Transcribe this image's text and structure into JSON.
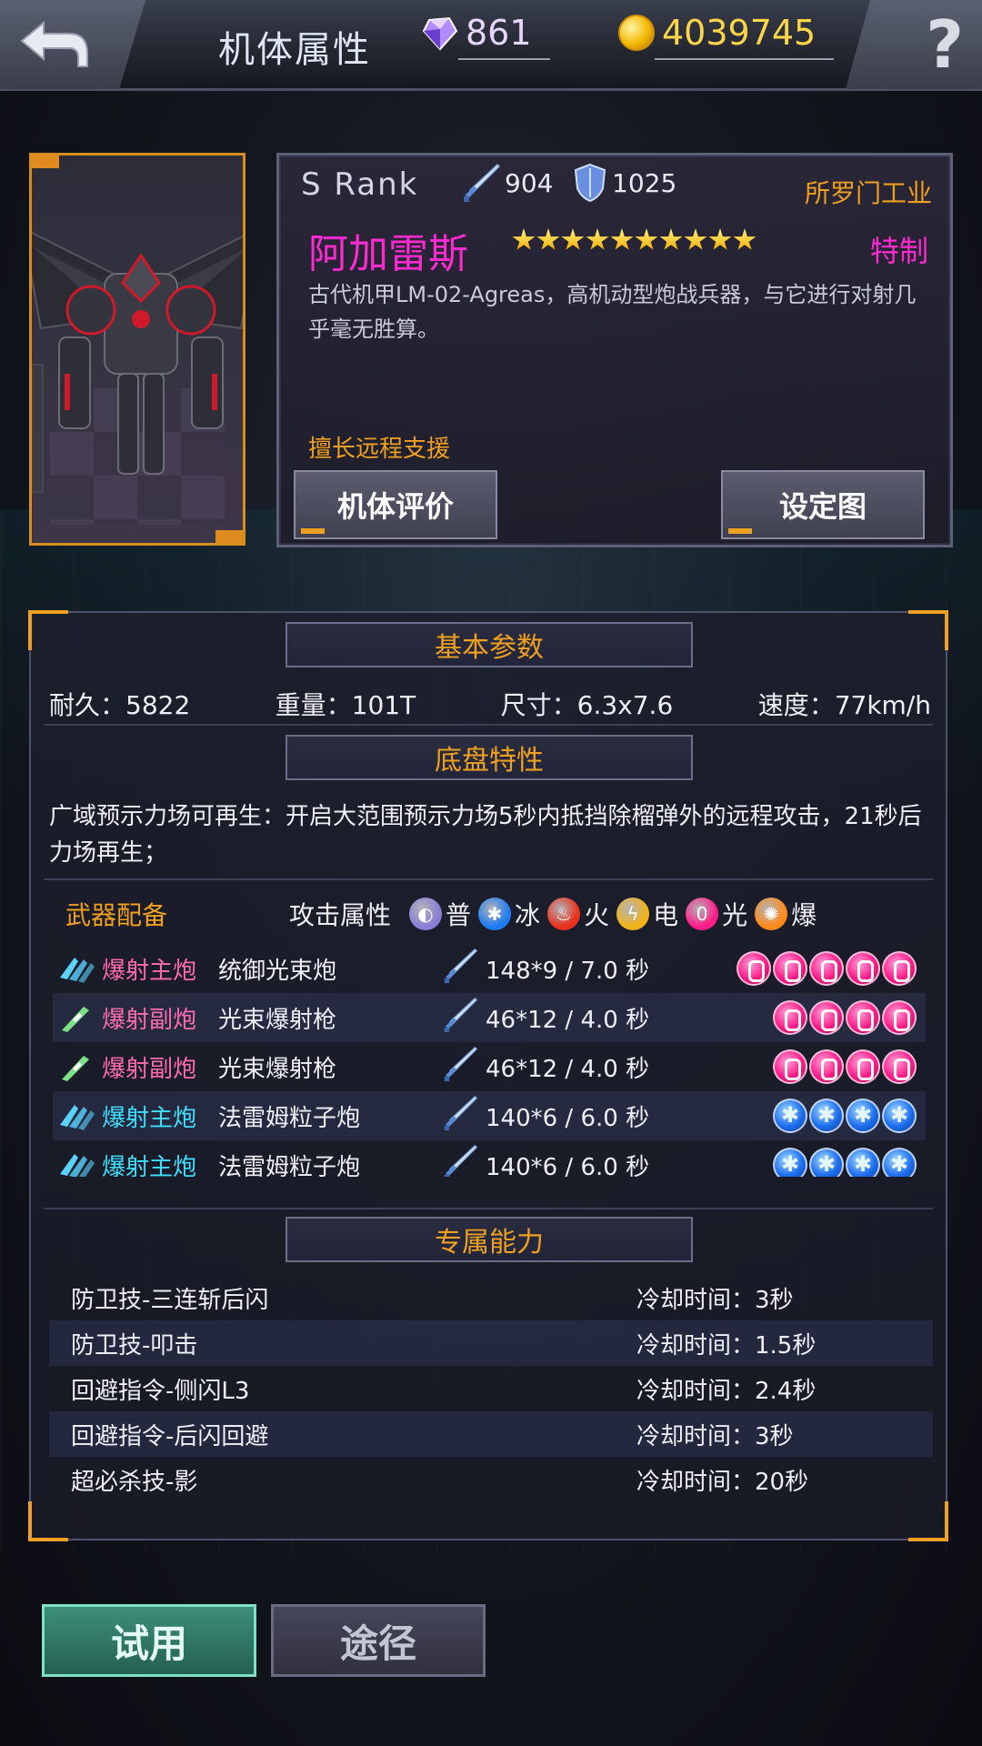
{
  "header": {
    "title": "机体属性",
    "gems": "861",
    "gold": "4039745",
    "help_label": "?"
  },
  "mech": {
    "rank": "S  Rank",
    "attack": "904",
    "defense": "1025",
    "manufacturer": "所罗门工业",
    "name": "阿加雷斯",
    "stars": 10,
    "tag": "特制",
    "description": "古代机甲LM-02-Agreas，高机动型炮战兵器，与它进行对射几乎毫无胜算。",
    "specialty": "擅长远程支援",
    "eval_button": "机体评价",
    "design_button": "设定图"
  },
  "basic": {
    "title": "基本参数",
    "durability": "耐久：5822",
    "weight": "重量：101T",
    "size": "尺寸：6.3x7.6",
    "speed": "速度：77km/h"
  },
  "chassis": {
    "title": "底盘特性",
    "text": "广域预示力场可再生：开启大范围预示力场5秒内抵挡除榴弹外的远程攻击，21秒后力场再生；"
  },
  "weapons": {
    "title": "武器配备",
    "attr_label": "攻击属性",
    "elements": [
      {
        "label": "普",
        "color": "#8a7fd6",
        "icon": "normal-element-icon"
      },
      {
        "label": "冰",
        "color": "#1f7cf0",
        "icon": "ice-element-icon"
      },
      {
        "label": "火",
        "color": "#e8321e",
        "icon": "fire-element-icon"
      },
      {
        "label": "电",
        "color": "#f2b21a",
        "icon": "electric-element-icon"
      },
      {
        "label": "光",
        "color": "#ff1d8a",
        "icon": "light-element-icon"
      },
      {
        "label": "爆",
        "color": "#ff8a1a",
        "icon": "explosion-element-icon"
      }
    ],
    "rows": [
      {
        "type": "爆射主炮",
        "name": "统御光束炮",
        "stat": "148*9  / 7.0 秒",
        "element": "light",
        "orbs": 5,
        "type_color": "pink",
        "icon": "main-cannon-icon"
      },
      {
        "type": "爆射副炮",
        "name": "光束爆射枪",
        "stat": "46*12  / 4.0 秒",
        "element": "light",
        "orbs": 4,
        "type_color": "pink",
        "icon": "sub-cannon-icon"
      },
      {
        "type": "爆射副炮",
        "name": "光束爆射枪",
        "stat": "46*12  / 4.0 秒",
        "element": "light",
        "orbs": 4,
        "type_color": "pink",
        "icon": "sub-cannon-icon"
      },
      {
        "type": "爆射主炮",
        "name": "法雷姆粒子炮",
        "stat": "140*6  / 6.0 秒",
        "element": "ice",
        "orbs": 4,
        "type_color": "cyan",
        "icon": "main-cannon-icon"
      },
      {
        "type": "爆射主炮",
        "name": "法雷姆粒子炮",
        "stat": "140*6  / 6.0 秒",
        "element": "ice",
        "orbs": 4,
        "type_color": "cyan",
        "icon": "main-cannon-icon"
      }
    ]
  },
  "abilities": {
    "title": "专属能力",
    "items": [
      {
        "name": "防卫技-三连斩后闪",
        "cooldown": "冷却时间：3秒"
      },
      {
        "name": "防卫技-叩击",
        "cooldown": "冷却时间：1.5秒"
      },
      {
        "name": "回避指令-侧闪L3",
        "cooldown": "冷却时间：2.4秒"
      },
      {
        "name": "回避指令-后闪回避",
        "cooldown": "冷却时间：3秒"
      },
      {
        "name": "超必杀技-影",
        "cooldown": "冷却时间：20秒"
      }
    ]
  },
  "bottom": {
    "try_label": "试用",
    "source_label": "途径"
  }
}
